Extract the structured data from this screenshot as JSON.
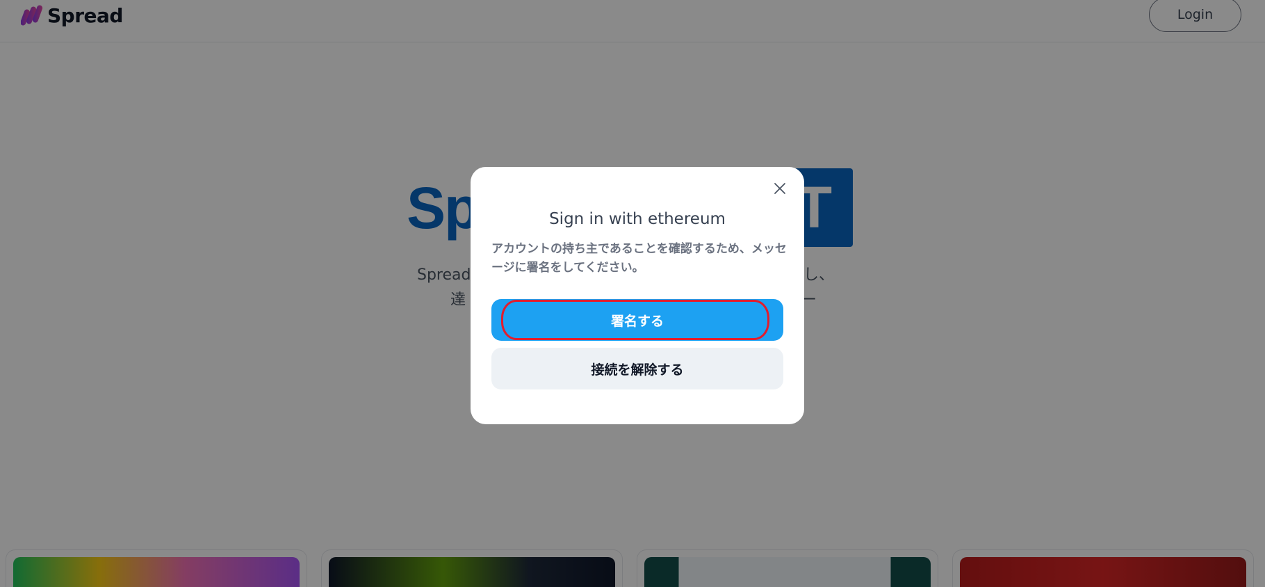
{
  "header": {
    "brand": "Spread",
    "login_label": "Login"
  },
  "hero": {
    "title_visible": "Sp",
    "badge_visible": "T",
    "subtitle_line1_left": "Spread",
    "subtitle_line1_right": "し、",
    "subtitle_line2_left": "達",
    "subtitle_line2_right": "ー"
  },
  "modal": {
    "title": "Sign in with ethereum",
    "description": "アカウントの持ち主であることを確認するため、メッセージに署名をしてください。",
    "sign_label": "署名する",
    "disconnect_label": "接続を解除する",
    "close_icon": "close-icon"
  },
  "colors": {
    "brand_blue": "#0a66c2",
    "sign_button": "#1da1f2",
    "highlight": "#e11d2e",
    "overlay": "rgba(0,0,0,0.46)"
  }
}
